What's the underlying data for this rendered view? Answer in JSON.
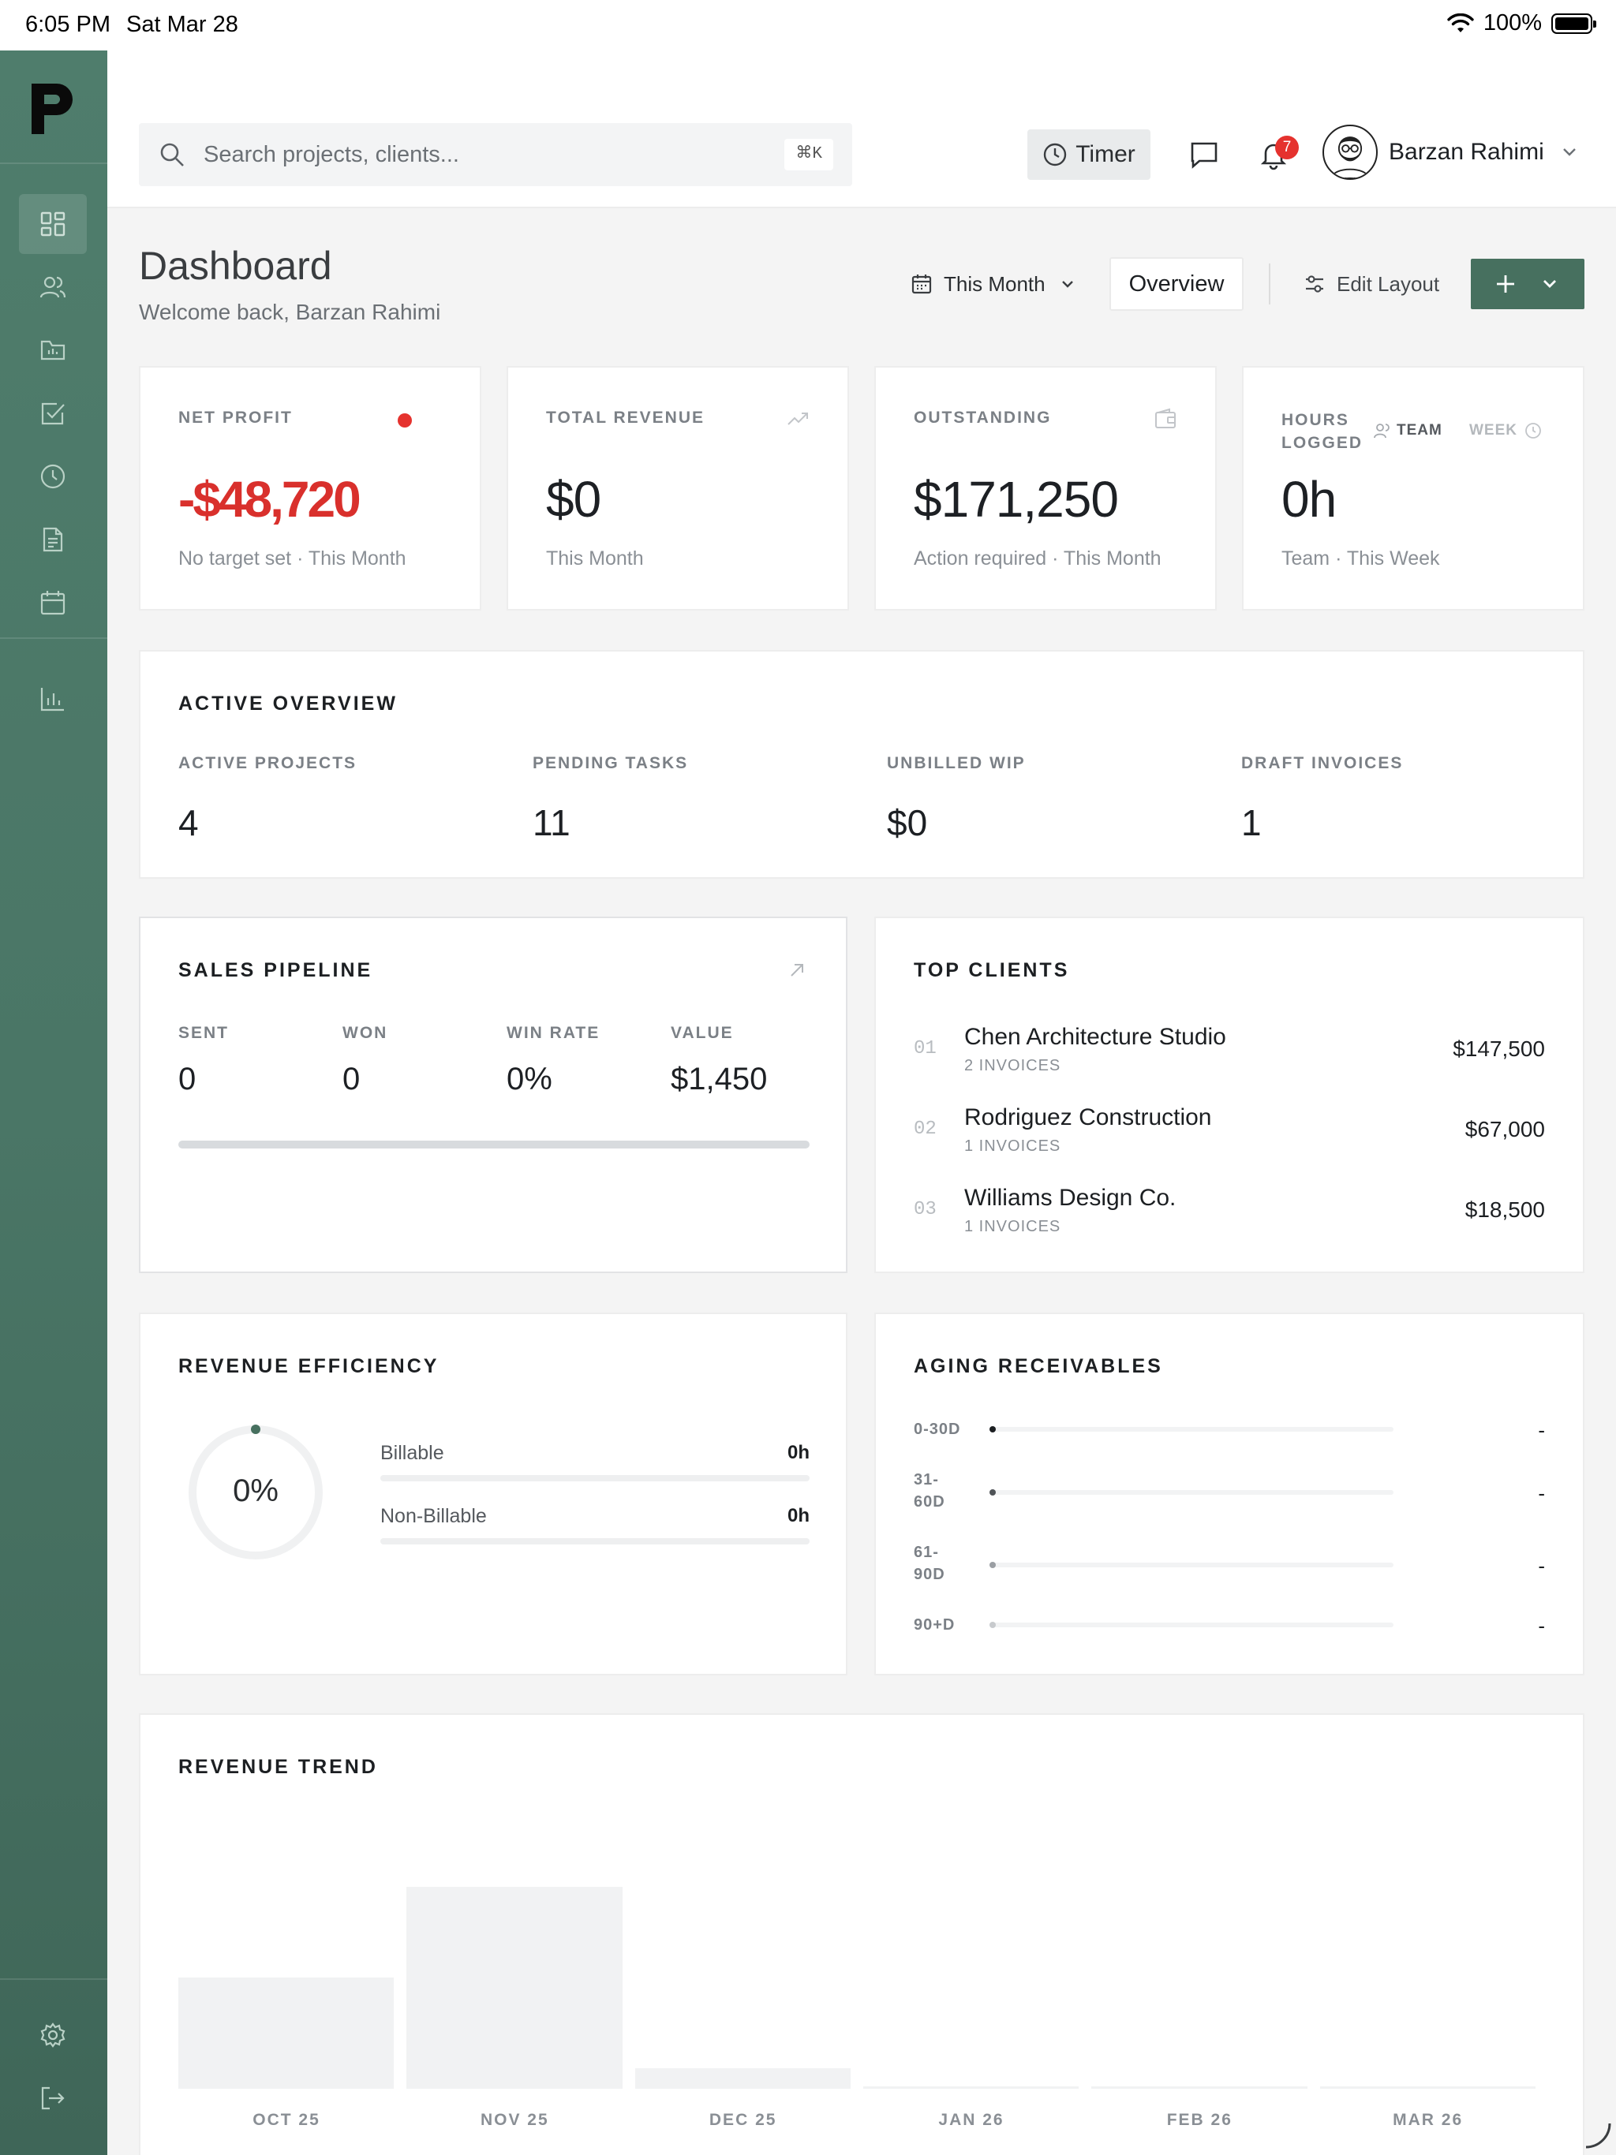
{
  "status_bar": {
    "time": "6:05 PM",
    "date": "Sat Mar 28",
    "battery": "100%"
  },
  "sidebar": {
    "icons": [
      "dashboard-icon",
      "clients-icon",
      "projects-icon",
      "tasks-icon",
      "time-icon",
      "invoices-icon",
      "calendar-icon",
      "reports-icon",
      "settings-icon",
      "logout-icon"
    ],
    "active": "dashboard-icon",
    "accent": "#4a7666"
  },
  "topbar": {
    "search_placeholder": "Search projects, clients...",
    "shortcut": "⌘K",
    "timer_label": "Timer",
    "notification_count": "7",
    "user_name": "Barzan Rahimi"
  },
  "header": {
    "title": "Dashboard",
    "subtitle": "Welcome back, Barzan Rahimi",
    "period_label": "This Month",
    "overview_label": "Overview",
    "edit_layout_label": "Edit Layout"
  },
  "kpis": {
    "net_profit": {
      "label": "NET PROFIT",
      "value": "-$48,720",
      "sub": "No target set · This Month"
    },
    "total_revenue": {
      "label": "TOTAL REVENUE",
      "value": "$0",
      "sub": "This Month"
    },
    "outstanding": {
      "label": "OUTSTANDING",
      "value": "$171,250",
      "sub": "Action required · This Month"
    },
    "hours_logged": {
      "label_line1": "HOURS",
      "label_line2": "LOGGED",
      "toggle_team": "TEAM",
      "toggle_week": "WEEK",
      "value": "0h",
      "sub": "Team · This Week"
    }
  },
  "active_overview": {
    "title": "ACTIVE OVERVIEW",
    "items": [
      {
        "label": "ACTIVE PROJECTS",
        "value": "4"
      },
      {
        "label": "PENDING TASKS",
        "value": "11"
      },
      {
        "label": "UNBILLED WIP",
        "value": "$0"
      },
      {
        "label": "DRAFT INVOICES",
        "value": "1"
      }
    ]
  },
  "sales_pipeline": {
    "title": "SALES PIPELINE",
    "items": [
      {
        "label": "SENT",
        "value": "0"
      },
      {
        "label": "WON",
        "value": "0"
      },
      {
        "label": "WIN RATE",
        "value": "0%"
      },
      {
        "label": "VALUE",
        "value": "$1,450"
      }
    ]
  },
  "top_clients": {
    "title": "TOP CLIENTS",
    "rows": [
      {
        "idx": "01",
        "name": "Chen Architecture Studio",
        "meta": "2 INVOICES",
        "amount": "$147,500"
      },
      {
        "idx": "02",
        "name": "Rodriguez Construction",
        "meta": "1 INVOICES",
        "amount": "$67,000"
      },
      {
        "idx": "03",
        "name": "Williams Design Co.",
        "meta": "1 INVOICES",
        "amount": "$18,500"
      }
    ]
  },
  "revenue_efficiency": {
    "title": "REVENUE EFFICIENCY",
    "percent": "0%",
    "rows": [
      {
        "name": "Billable",
        "value": "0h"
      },
      {
        "name": "Non-Billable",
        "value": "0h"
      }
    ]
  },
  "aging_receivables": {
    "title": "AGING RECEIVABLES",
    "rows": [
      {
        "label": "0-30D",
        "value": "-"
      },
      {
        "label": "31-60D",
        "value": "-"
      },
      {
        "label": "61-90D",
        "value": "-"
      },
      {
        "label": "90+D",
        "value": "-"
      }
    ]
  },
  "revenue_trend": {
    "title": "REVENUE TREND",
    "bar_color": "#f1f2f3"
  },
  "chart_data": {
    "type": "bar",
    "title": "REVENUE TREND",
    "categories": [
      "OCT 25",
      "NOV 25",
      "DEC 25",
      "JAN 26",
      "FEB 26",
      "MAR 26"
    ],
    "values": [
      55000,
      100000,
      10000,
      0,
      0,
      0
    ],
    "ylim": [
      0,
      100000
    ],
    "grid": false,
    "legend": "none"
  }
}
